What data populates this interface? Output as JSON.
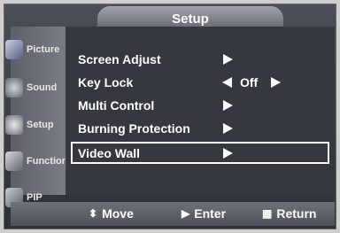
{
  "title": "Setup",
  "sidebar": {
    "items": [
      {
        "label": "Picture",
        "icon": "picture-icon"
      },
      {
        "label": "Sound",
        "icon": "sound-icon"
      },
      {
        "label": "Setup",
        "icon": "setup-icon"
      },
      {
        "label": "Function",
        "icon": "function-icon"
      },
      {
        "label": "PIP",
        "icon": "pip-icon"
      }
    ]
  },
  "menu": {
    "items": [
      {
        "label": "Screen Adjust",
        "value": ""
      },
      {
        "label": "Key Lock",
        "value": "Off"
      },
      {
        "label": "Multi Control",
        "value": ""
      },
      {
        "label": "Burning Protection",
        "value": ""
      },
      {
        "label": "Video Wall",
        "value": ""
      }
    ],
    "selected": "Video Wall"
  },
  "footer": {
    "move_label": "Move",
    "enter_label": "Enter",
    "return_label": "Return",
    "move_icon": "up-down-arrow-icon",
    "enter_icon": "enter-icon",
    "return_icon": "return-icon"
  }
}
